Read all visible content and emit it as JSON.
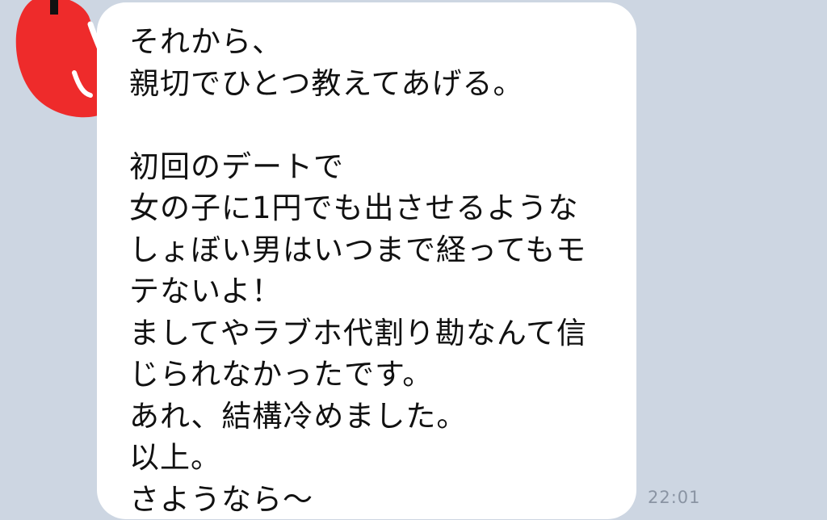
{
  "chat": {
    "message": {
      "lines": [
        "それから、",
        "親切でひとつ教えてあげる。",
        "",
        "初回のデートで",
        "女の子に1円でも出させるような",
        "しょぼい男はいつまで経ってもモ",
        "テないよ！",
        "ましてやラブホ代割り勘なんて信",
        "じられなかったです。",
        "あれ、結構冷めました。",
        "以上。",
        "さようなら〜"
      ],
      "time": "22:01"
    },
    "avatar": {
      "icon": "redacted-avatar-scribble",
      "scribble_color": "#ee2b2b"
    },
    "colors": {
      "background": "#cdd6e2",
      "bubble": "#ffffff",
      "text": "#111111",
      "timestamp": "#8a94a3"
    }
  }
}
